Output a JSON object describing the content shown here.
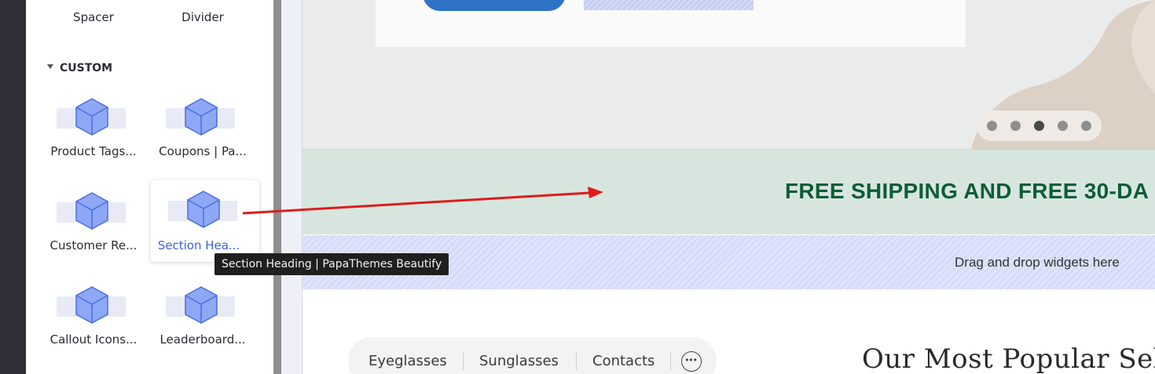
{
  "sidebar": {
    "top_widgets": [
      {
        "label": "Spacer"
      },
      {
        "label": "Divider"
      }
    ],
    "section": {
      "title": "CUSTOM"
    },
    "widgets": [
      {
        "label": "Product Tags..."
      },
      {
        "label": "Coupons | Pa..."
      },
      {
        "label": "Customer Re..."
      },
      {
        "label": "Section Hea..."
      },
      {
        "label": "Callout Icons..."
      },
      {
        "label": "Leaderboard..."
      }
    ],
    "tooltip": "Section Heading | PapaThemes Beautify",
    "icon": "cube-icon",
    "active_color": "#3f63d4"
  },
  "canvas": {
    "carousel_dots": {
      "count": 5,
      "active_index": 2
    },
    "shipping_banner": {
      "text": "FREE SHIPPING AND FREE 30-DA",
      "color": "#0f5c36",
      "background": "#d6e6df"
    },
    "drop_zone": {
      "text": "Drag and drop widgets here"
    },
    "tabs": [
      {
        "label": "Eyeglasses"
      },
      {
        "label": "Sunglasses"
      },
      {
        "label": "Contacts"
      }
    ],
    "more_icon": "more-horizontal-icon",
    "section_heading": "Our Most Popular Selec"
  },
  "drag_arrow_color": "#e01b1b"
}
